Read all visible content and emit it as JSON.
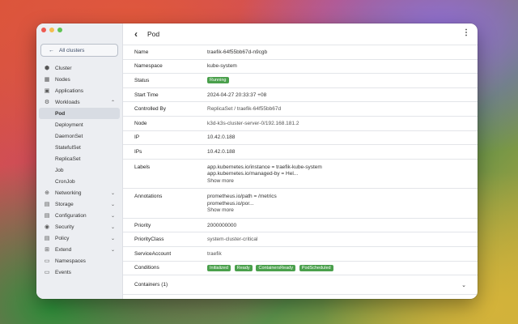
{
  "sidebar": {
    "back_label": "All clusters",
    "items": [
      {
        "label": "Cluster",
        "icon": "cluster-icon",
        "glyph": "⬢"
      },
      {
        "label": "Nodes",
        "icon": "nodes-icon",
        "glyph": "▦"
      },
      {
        "label": "Applications",
        "icon": "applications-icon",
        "glyph": "▣"
      },
      {
        "label": "Workloads",
        "icon": "workloads-icon",
        "glyph": "⚙",
        "expanded": true
      }
    ],
    "workloads": [
      "Pod",
      "Deployment",
      "DaemonSet",
      "StatefulSet",
      "ReplicaSet",
      "Job",
      "CronJob"
    ],
    "items_after": [
      {
        "label": "Networking",
        "icon": "networking-icon",
        "glyph": "⊕",
        "chevron": true
      },
      {
        "label": "Storage",
        "icon": "storage-icon",
        "glyph": "▤",
        "chevron": true
      },
      {
        "label": "Configuration",
        "icon": "configuration-icon",
        "glyph": "▤",
        "chevron": true
      },
      {
        "label": "Security",
        "icon": "security-icon",
        "glyph": "◉",
        "chevron": true
      },
      {
        "label": "Policy",
        "icon": "policy-icon",
        "glyph": "▤",
        "chevron": true
      },
      {
        "label": "Extend",
        "icon": "extend-icon",
        "glyph": "⊞",
        "chevron": true
      },
      {
        "label": "Namespaces",
        "icon": "namespaces-icon",
        "glyph": "▭"
      },
      {
        "label": "Events",
        "icon": "events-icon",
        "glyph": "▭"
      }
    ]
  },
  "header": {
    "title": "Pod"
  },
  "details": {
    "name": {
      "label": "Name",
      "value": "traefik-64f55bb67d-n9cgb"
    },
    "namespace": {
      "label": "Namespace",
      "value": "kube-system"
    },
    "status": {
      "label": "Status",
      "value": "Running"
    },
    "start_time": {
      "label": "Start Time",
      "value": "2024-04-27 20:33:37 +08"
    },
    "controlled_by": {
      "label": "Controlled By",
      "value": "ReplicaSet / traefik-64f55bb67d"
    },
    "node": {
      "label": "Node",
      "value": "k3d-k3s-cluster-server-0/192.168.181.2"
    },
    "ip": {
      "label": "IP",
      "value": "10.42.0.188"
    },
    "ips": {
      "label": "IPs",
      "value": "10.42.0.188"
    },
    "labels": {
      "label": "Labels",
      "line1": "app.kubernetes.io/instance = traefik-kube-system",
      "line2": "app.kubernetes.io/managed-by = Hel...",
      "more": "Show more"
    },
    "annotations": {
      "label": "Annotations",
      "line1": "prometheus.io/path = /metrics",
      "line2": "prometheus.io/por...",
      "more": "Show more"
    },
    "priority": {
      "label": "Priority",
      "value": "2000000000"
    },
    "priority_class": {
      "label": "PriorityClass",
      "value": "system-cluster-critical"
    },
    "service_account": {
      "label": "ServiceAccount",
      "value": "traefik"
    },
    "conditions": {
      "label": "Conditions",
      "badges": [
        "Initialized",
        "Ready",
        "ContainersReady",
        "PodScheduled"
      ]
    },
    "containers": {
      "label": "Containers (1)"
    }
  },
  "colors": {
    "badge_green": "#4aa04c"
  }
}
